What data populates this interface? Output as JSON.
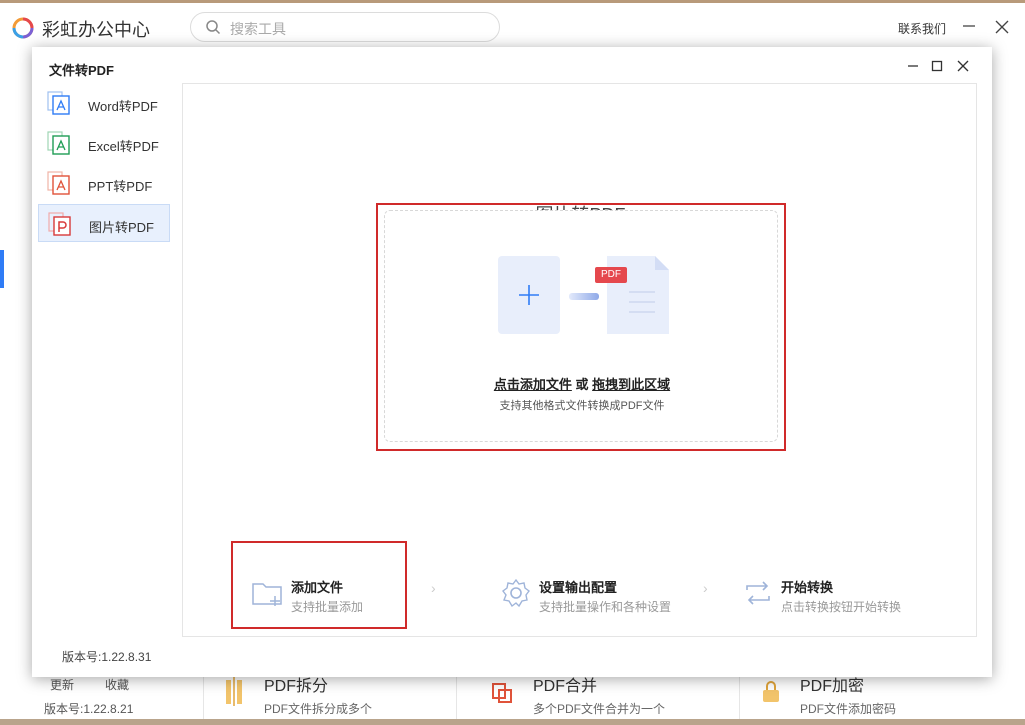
{
  "app": {
    "title": "彩虹办公中心",
    "search_placeholder": "搜索工具",
    "contact": "联系我们",
    "bottom_links": [
      "更新",
      "收藏"
    ],
    "version": "版本号:1.22.8.21",
    "tools": [
      {
        "title": "PDF拆分",
        "desc": "PDF文件拆分成多个",
        "icon": "split-icon"
      },
      {
        "title": "PDF合并",
        "desc": "多个PDF文件合并为一个",
        "icon": "merge-icon"
      },
      {
        "title": "PDF加密",
        "desc": "PDF文件添加密码",
        "icon": "lock-icon"
      }
    ]
  },
  "dialog": {
    "title": "文件转PDF",
    "version": "版本号:1.22.8.31",
    "sidebar": [
      {
        "label": "Word转PDF",
        "icon": "word-pdf-icon",
        "color": "#2f7cf6"
      },
      {
        "label": "Excel转PDF",
        "icon": "excel-pdf-icon",
        "color": "#1f9d55"
      },
      {
        "label": "PPT转PDF",
        "icon": "ppt-pdf-icon",
        "color": "#e0533a"
      },
      {
        "label": "图片转PDF",
        "icon": "image-pdf-icon",
        "color": "#d83a3a",
        "active": true
      }
    ],
    "content": {
      "title": "图片转PDF",
      "dropzone": {
        "badge": "PDF",
        "action_add": "点击添加文件",
        "or": "或",
        "action_drag": "拖拽到此区域",
        "sub": "支持其他格式文件转换成PDF文件"
      },
      "steps": [
        {
          "title": "添加文件",
          "desc": "支持批量添加",
          "icon": "add-folder-icon"
        },
        {
          "title": "设置输出配置",
          "desc": "支持批量操作和各种设置",
          "icon": "gear-icon"
        },
        {
          "title": "开始转换",
          "desc": "点击转换按钮开始转换",
          "icon": "convert-icon"
        }
      ]
    }
  },
  "colors": {
    "accent": "#2f7cf6",
    "highlight": "#d02a2a"
  }
}
